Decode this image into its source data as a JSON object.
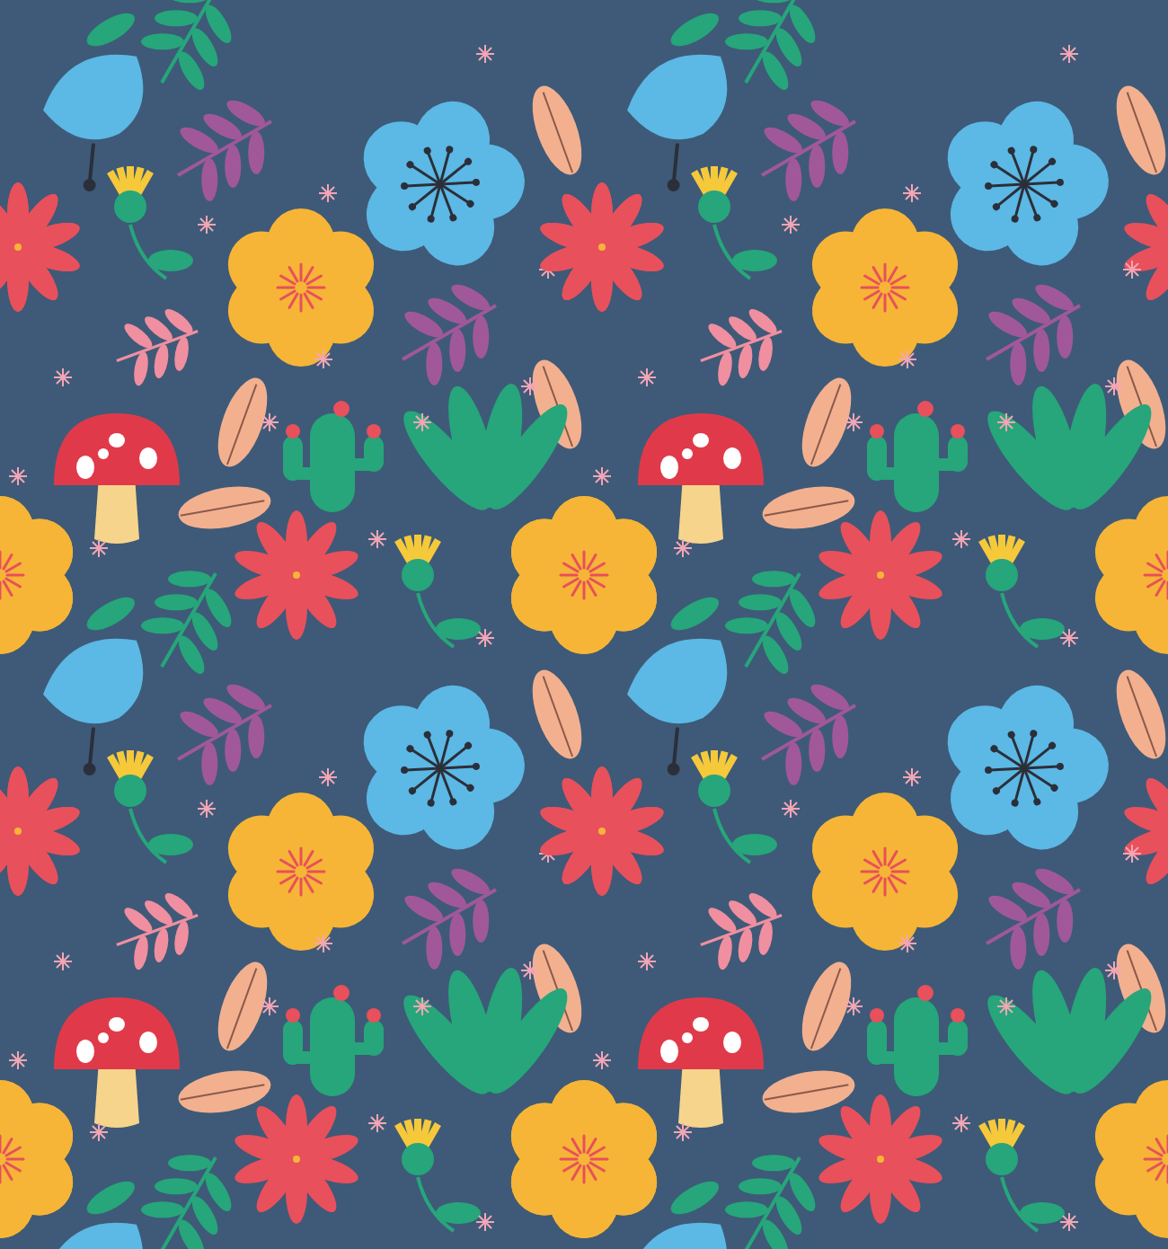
{
  "pattern": {
    "kind": "floral"
  }
}
